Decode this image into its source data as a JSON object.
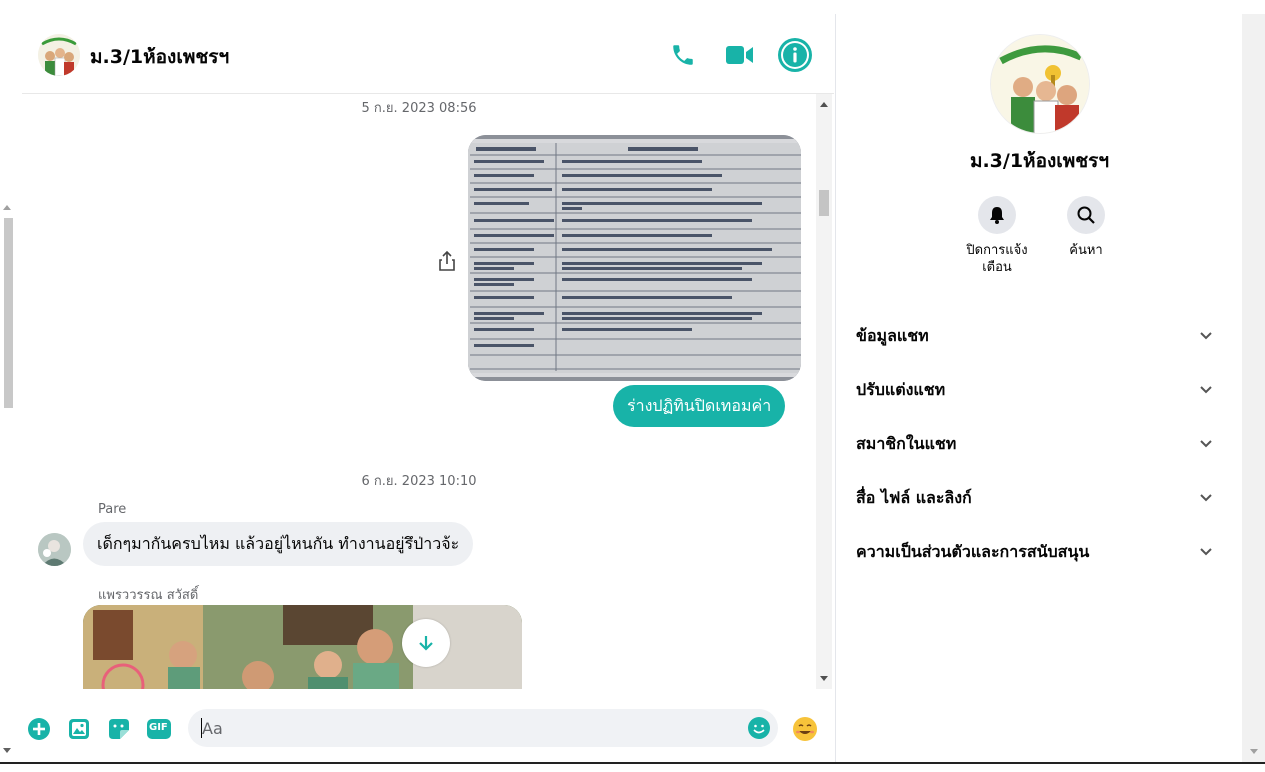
{
  "chat": {
    "title": "ม.3/1ห้องเพชรฯ",
    "header_icons": [
      "phone-icon",
      "video-icon",
      "info-icon"
    ],
    "messages": {
      "date1": "5 ก.ย. 2023 08:56",
      "outgoing_text": "ร่างปฏิทินปิดเทอมค่า",
      "date2": "6 ก.ย. 2023 10:10",
      "sender1": "Pare",
      "incoming_text": "เด็กๆมากันครบไหม แล้วอยู่ไหนกัน ทำงานอยู่รึป่าวจ้ะ",
      "sender2": "แพรววรรณ สวัสดิ์"
    },
    "composer": {
      "placeholder": "Aa",
      "icons": [
        "plus-icon",
        "image-icon",
        "sticker-icon",
        "gif-icon",
        "emoji-icon",
        "reaction-emoji-icon"
      ],
      "gif_label": "GIF"
    }
  },
  "panel": {
    "name": "ม.3/1ห้องเพชรฯ",
    "actions": [
      {
        "icon": "bell-icon",
        "label": "ปิดการแจ้งเตือน"
      },
      {
        "icon": "search-icon",
        "label": "ค้นหา"
      }
    ],
    "sections": [
      "ข้อมูลแชท",
      "ปรับแต่งแชท",
      "สมาชิกในแชท",
      "สื่อ ไฟล์ และลิงก์",
      "ความเป็นส่วนตัวและการสนับสนุน"
    ]
  },
  "colors": {
    "accent": "#18b3a8",
    "bubble_in": "#eef0f3",
    "input_bg": "#f0f2f5"
  }
}
